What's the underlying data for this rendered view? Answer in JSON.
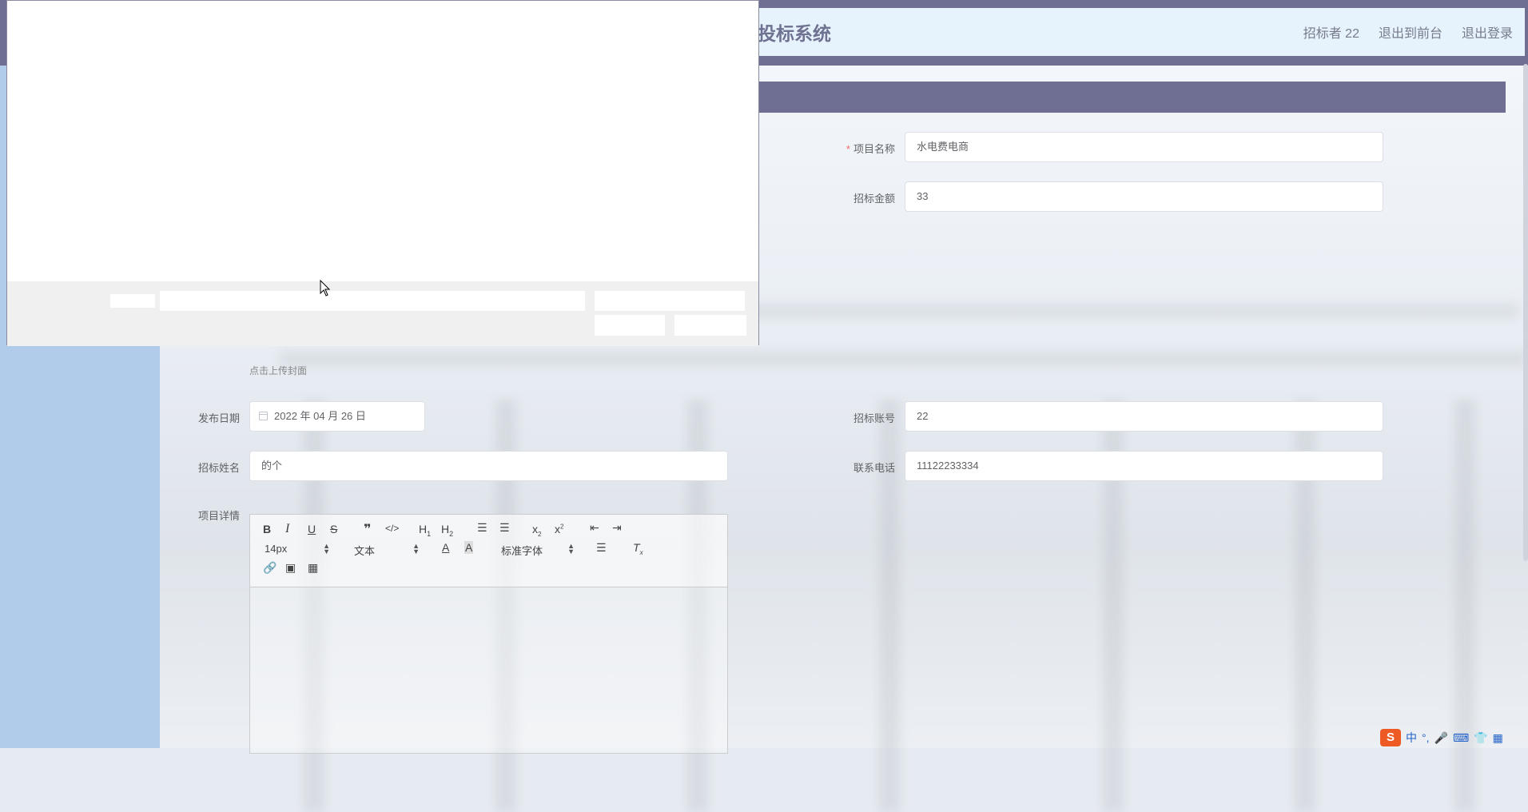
{
  "header": {
    "title": "投标系统",
    "nav": [
      "招标者 22",
      "退出到前台",
      "退出登录"
    ]
  },
  "form": {
    "project_name": {
      "label": "项目名称",
      "value": "水电费电商"
    },
    "amount": {
      "label": "招标金额",
      "value": "33"
    },
    "cover_hint": "点击上传封面",
    "publish_date": {
      "label": "发布日期",
      "value": "2022 年 04 月 26 日"
    },
    "account": {
      "label": "招标账号",
      "value": "22"
    },
    "tender_name": {
      "label": "招标姓名",
      "value": "的个"
    },
    "phone": {
      "label": "联系电话",
      "value": "11122233334"
    },
    "details": {
      "label": "项目详情"
    }
  },
  "editor": {
    "font_size": "14px",
    "header_select": "文本",
    "font_family": "标准字体"
  },
  "ime": {
    "lang": "中",
    "punct": "°,"
  },
  "colors": {
    "accent": "#6f6e93",
    "header_bg": "#e6f3fd",
    "sidebar": "#b1cbeb"
  }
}
